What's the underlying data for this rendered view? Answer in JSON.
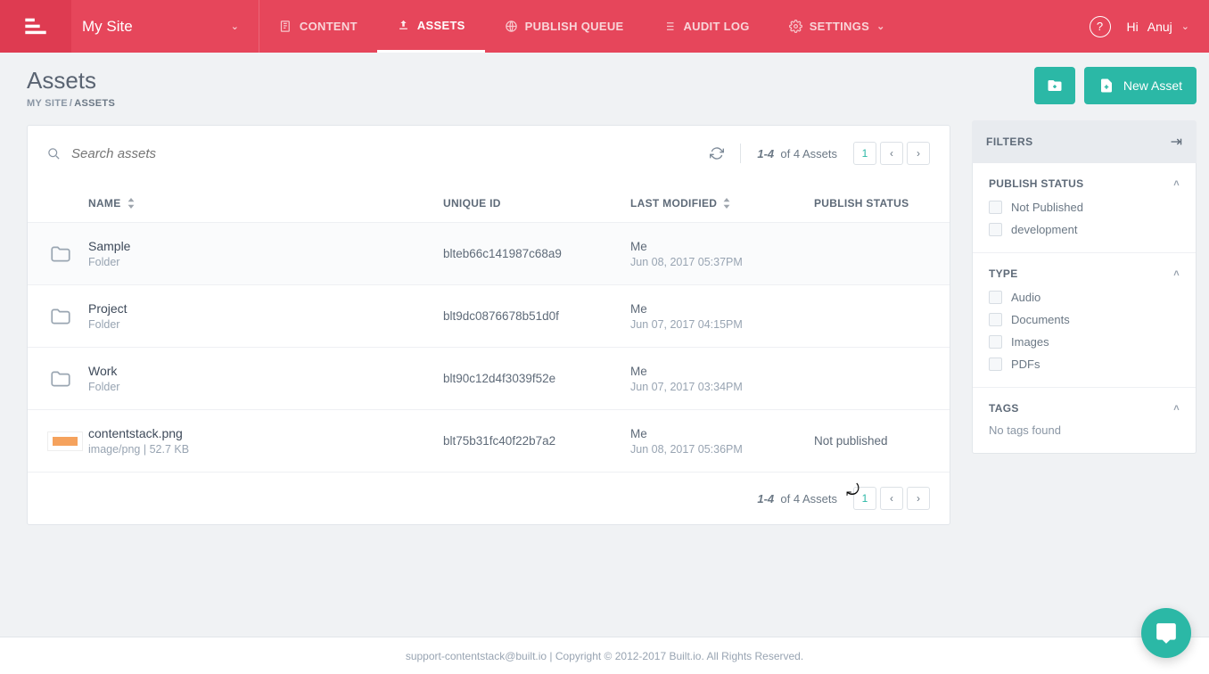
{
  "header": {
    "site_label": "My Site",
    "tabs": {
      "content": "CONTENT",
      "assets": "ASSETS",
      "publish_queue": "PUBLISH QUEUE",
      "audit_log": "AUDIT LOG",
      "settings": "SETTINGS"
    },
    "user_greeting": "Hi",
    "user_name": "Anuj"
  },
  "page": {
    "title": "Assets",
    "breadcrumb": {
      "root": "MY SITE",
      "current": "ASSETS"
    },
    "new_folder_tooltip": "New Folder",
    "new_asset_label": "New Asset"
  },
  "search": {
    "placeholder": "Search assets"
  },
  "pager": {
    "range": "1-4",
    "of_text": "of 4 Assets",
    "current": "1"
  },
  "columns": {
    "name": "NAME",
    "unique_id": "UNIQUE ID",
    "last_modified": "LAST MODIFIED",
    "publish_status": "PUBLISH STATUS"
  },
  "rows": [
    {
      "title": "Sample",
      "subtitle": "Folder",
      "uid": "blteb66c141987c68a9",
      "modified_by": "Me",
      "modified_at": "Jun 08, 2017 05:37PM",
      "publish_status": "",
      "icon": "folder"
    },
    {
      "title": "Project",
      "subtitle": "Folder",
      "uid": "blt9dc0876678b51d0f",
      "modified_by": "Me",
      "modified_at": "Jun 07, 2017 04:15PM",
      "publish_status": "",
      "icon": "folder"
    },
    {
      "title": "Work",
      "subtitle": "Folder",
      "uid": "blt90c12d4f3039f52e",
      "modified_by": "Me",
      "modified_at": "Jun 07, 2017 03:34PM",
      "publish_status": "",
      "icon": "folder"
    },
    {
      "title": "contentstack.png",
      "subtitle": "image/png  | 52.7 KB",
      "uid": "blt75b31fc40f22b7a2",
      "modified_by": "Me",
      "modified_at": "Jun 08, 2017 05:36PM",
      "publish_status": "Not published",
      "icon": "image"
    }
  ],
  "filters": {
    "title": "FILTERS",
    "publish_status": {
      "title": "PUBLISH STATUS",
      "options": [
        "Not Published",
        "development"
      ]
    },
    "type": {
      "title": "TYPE",
      "options": [
        "Audio",
        "Documents",
        "Images",
        "PDFs"
      ]
    },
    "tags": {
      "title": "TAGS",
      "empty": "No tags found"
    }
  },
  "footer": {
    "text": "support-contentstack@built.io | Copyright © 2012-2017 Built.io. All Rights Reserved."
  }
}
